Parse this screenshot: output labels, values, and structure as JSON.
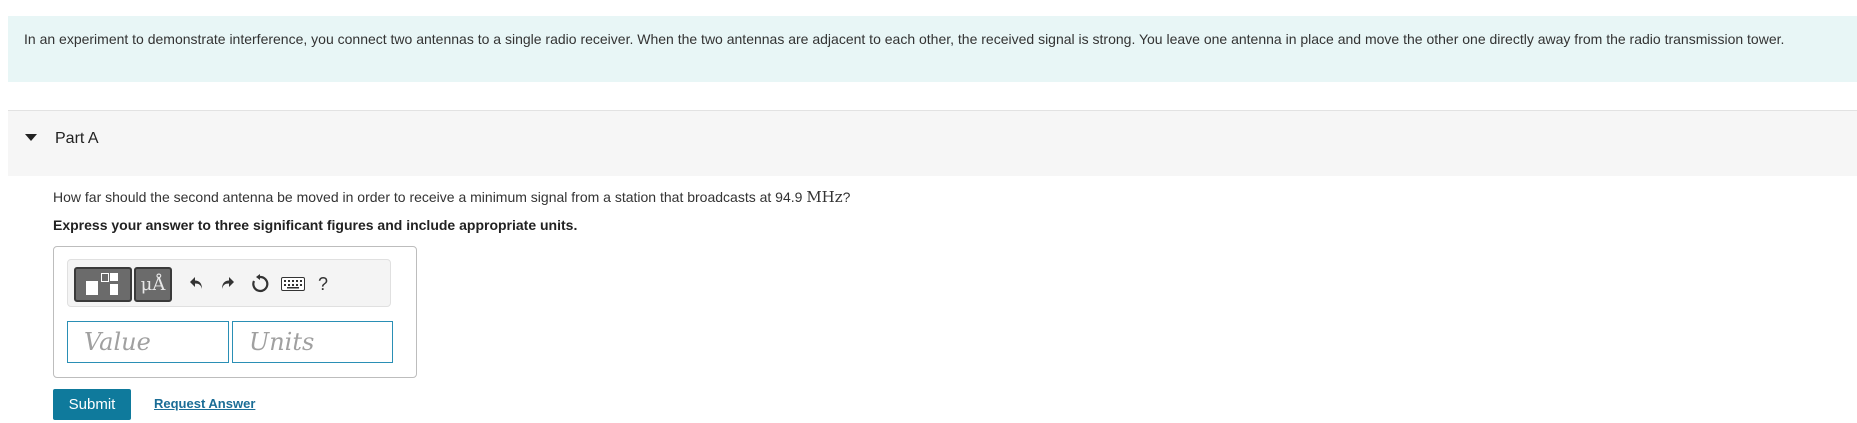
{
  "intro": {
    "text": "In an experiment to demonstrate interference, you connect two antennas to a single radio receiver. When the two antennas are adjacent to each other, the received signal is strong. You leave one antenna in place and move the other one directly away from the radio transmission tower."
  },
  "part": {
    "title": "Part A",
    "question_prefix": "How far should the second antenna be moved in order to receive a minimum signal from a station that broadcasts at 94.9",
    "question_unit": "MHz",
    "question_suffix": "?",
    "instruction": "Express your answer to three significant figures and include appropriate units."
  },
  "toolbar": {
    "units_label": "μÅ",
    "help_label": "?",
    "icons": [
      "templates-icon",
      "units-icon",
      "undo-icon",
      "redo-icon",
      "reset-icon",
      "keyboard-icon",
      "help-icon"
    ]
  },
  "answer": {
    "value_placeholder": "Value",
    "units_placeholder": "Units"
  },
  "actions": {
    "submit_label": "Submit",
    "request_label": "Request Answer"
  },
  "colors": {
    "intro_bg": "#e8f6f6",
    "accent": "#0f7a9c",
    "link": "#1b6d96",
    "field_border": "#2a8fb5"
  }
}
